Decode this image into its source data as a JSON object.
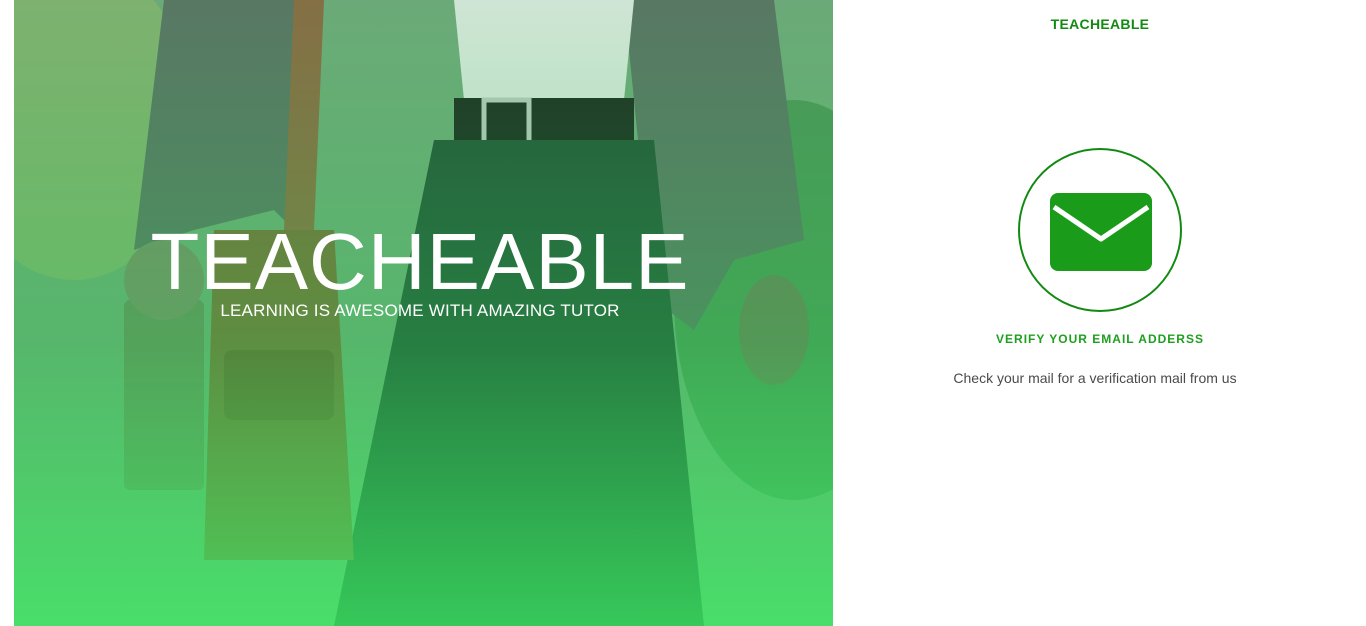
{
  "hero": {
    "title": "TEACHEABLE",
    "subtitle": "LEARNING IS AWESOME WITH AMAZING TUTOR"
  },
  "brand": {
    "name": "TEACHEABLE"
  },
  "verify": {
    "icon": "envelope-icon",
    "heading": "VERIFY YOUR EMAIL ADDERSS",
    "message": "Check your mail for a verification mail from us"
  },
  "colors": {
    "brand_green": "#128a12",
    "accent_green": "#1ea01e",
    "hero_tint": "#4ded6a"
  }
}
